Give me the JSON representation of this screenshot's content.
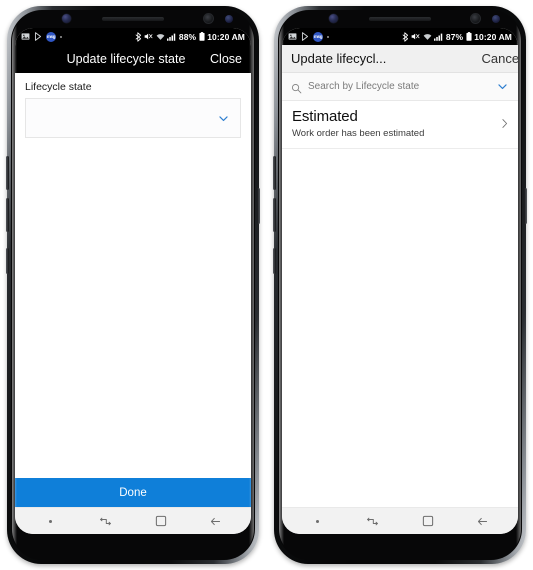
{
  "phones": [
    {
      "id": "left",
      "status_bar": {
        "icons_left": [
          "image-icon",
          "play-store-icon",
          "app-badge-icon",
          "overflow-dot-icon"
        ],
        "app_badge_text": "msg",
        "icons_right": [
          "bluetooth-icon",
          "mute-icon",
          "wifi-icon",
          "signal-icon"
        ],
        "battery_percent": "88%",
        "battery_icon": "battery-icon",
        "time": "10:20 AM"
      },
      "title_bar": {
        "title": "Update lifecycle state",
        "action_label": "Close",
        "theme": "dark"
      },
      "form": {
        "field_label": "Lifecycle state",
        "select_value": "",
        "dropdown_icon": "chevron-down-icon"
      },
      "primary_button": {
        "label": "Done",
        "color": "#0f7fd9"
      },
      "nav_bar": {
        "items": [
          "nav-dot-icon",
          "recents-icon",
          "home-icon",
          "back-icon"
        ]
      }
    },
    {
      "id": "right",
      "status_bar": {
        "icons_left": [
          "image-icon",
          "play-store-icon",
          "app-badge-icon",
          "overflow-dot-icon"
        ],
        "app_badge_text": "msg",
        "icons_right": [
          "bluetooth-icon",
          "mute-icon",
          "wifi-icon",
          "signal-icon"
        ],
        "battery_percent": "87%",
        "battery_icon": "battery-icon",
        "time": "10:20 AM"
      },
      "title_bar": {
        "title": "Update lifecycl...",
        "action_label": "Cancel",
        "theme": "light"
      },
      "search": {
        "placeholder": "Search by Lifecycle state",
        "search_icon": "search-icon",
        "collapse_icon": "chevron-down-icon"
      },
      "list": {
        "items": [
          {
            "title": "Estimated",
            "subtitle": "Work order has been estimated",
            "chevron_icon": "chevron-right-icon"
          }
        ]
      },
      "nav_bar": {
        "items": [
          "nav-dot-icon",
          "recents-icon",
          "home-icon",
          "back-icon"
        ]
      }
    }
  ],
  "colors": {
    "accent": "#0f7fd9",
    "chevron_blue": "#2f7fd0",
    "status_bar_bg": "#000000",
    "dark_title_bg": "#000000",
    "light_title_bg": "#f0f0f0",
    "nav_bar_bg": "#f2f2f2"
  }
}
